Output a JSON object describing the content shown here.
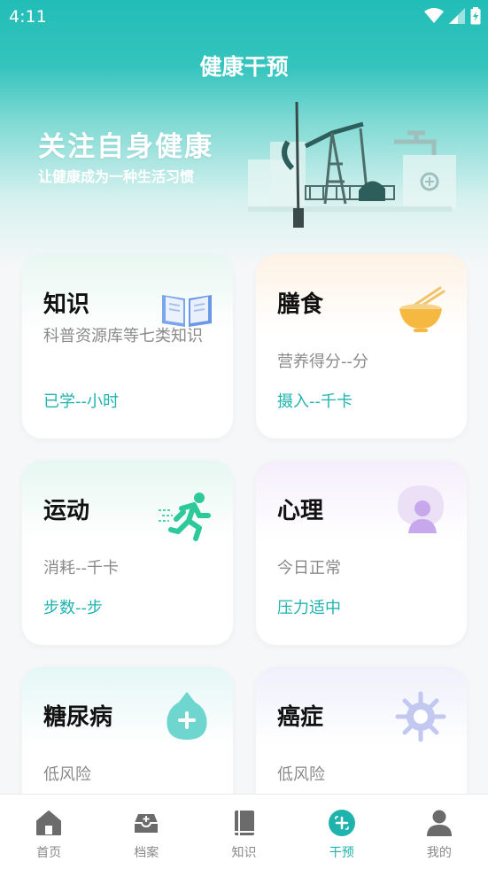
{
  "status_bar": {
    "time": "4:11"
  },
  "header": {
    "title": "健康干预"
  },
  "banner": {
    "title": "关注自身健康",
    "subtitle": "让健康成为一种生活习惯"
  },
  "cards": [
    {
      "title": "知识",
      "desc": "科普资源库等七类知识",
      "stat": "已学--小时",
      "icon": "book-icon"
    },
    {
      "title": "膳食",
      "desc": "营养得分--分",
      "stat": "摄入--千卡",
      "icon": "bowl-icon"
    },
    {
      "title": "运动",
      "desc": "消耗--千卡",
      "stat": "步数--步",
      "icon": "running-icon"
    },
    {
      "title": "心理",
      "desc": "今日正常",
      "stat": "压力适中",
      "icon": "person-bubble-icon"
    },
    {
      "title": "糖尿病",
      "desc": "低风险",
      "stat": "",
      "icon": "drop-plus-icon"
    },
    {
      "title": "癌症",
      "desc": "低风险",
      "stat": "",
      "icon": "virus-icon"
    }
  ],
  "tabbar": {
    "active": "干预",
    "items": [
      {
        "label": "首页",
        "icon": "home-icon"
      },
      {
        "label": "档案",
        "icon": "archive-icon"
      },
      {
        "label": "知识",
        "icon": "book-icon"
      },
      {
        "label": "干预",
        "icon": "intervention-icon"
      },
      {
        "label": "我的",
        "icon": "user-icon"
      }
    ]
  },
  "colors": {
    "accent": "#1fb3ae",
    "header": "#22bdb7"
  }
}
